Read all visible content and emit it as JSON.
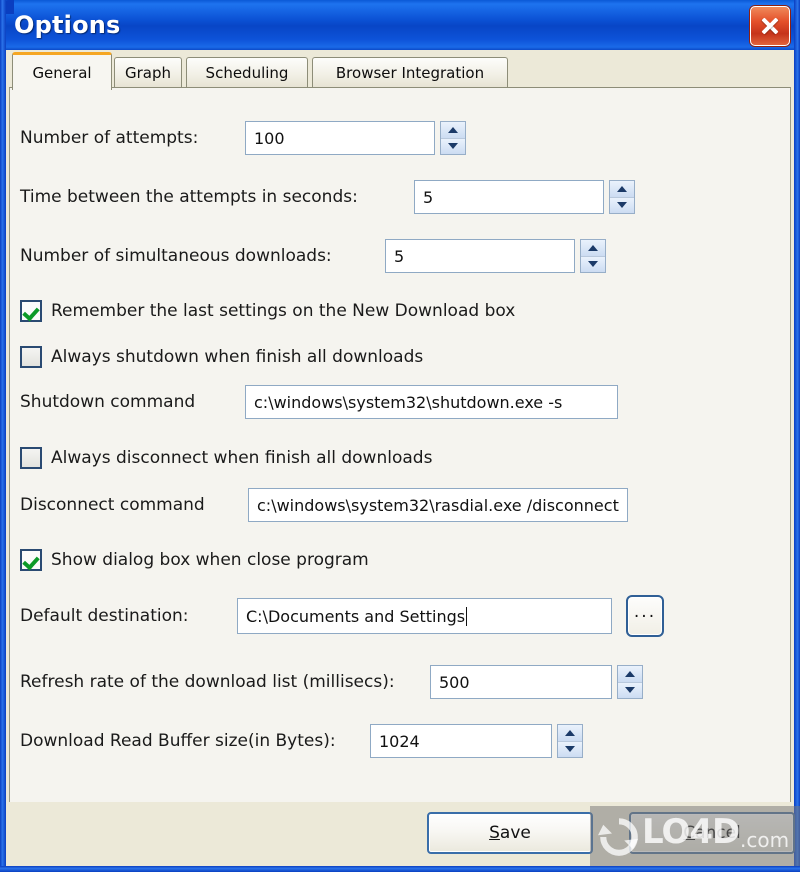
{
  "window": {
    "title": "Options",
    "close_label": "Close"
  },
  "tabs": [
    {
      "id": "general",
      "label": "General",
      "active": true
    },
    {
      "id": "graph",
      "label": "Graph",
      "active": false
    },
    {
      "id": "scheduling",
      "label": "Scheduling",
      "active": false
    },
    {
      "id": "browser",
      "label": "Browser Integration",
      "active": false
    }
  ],
  "general": {
    "attempts": {
      "label": "Number of attempts:",
      "value": "100"
    },
    "time_between": {
      "label": "Time between the attempts in seconds:",
      "value": "5"
    },
    "simultaneous": {
      "label": "Number of simultaneous downloads:",
      "value": "5"
    },
    "remember_settings": {
      "label": "Remember the last settings on the New Download box",
      "checked": true
    },
    "always_shutdown": {
      "label": "Always shutdown when finish all downloads",
      "checked": false
    },
    "shutdown_command": {
      "label": "Shutdown command",
      "value": "c:\\windows\\system32\\shutdown.exe -s"
    },
    "always_disconnect": {
      "label": "Always disconnect when finish all downloads",
      "checked": false
    },
    "disconnect_command": {
      "label": "Disconnect command",
      "value": "c:\\windows\\system32\\rasdial.exe /disconnect"
    },
    "show_dialog": {
      "label": "Show dialog box when close program",
      "checked": true
    },
    "default_destination": {
      "label": "Default destination:",
      "value": "C:\\Documents and Settings"
    },
    "browse": {
      "label": "..."
    },
    "refresh_rate": {
      "label": "Refresh rate of the download list (millisecs):",
      "value": "500"
    },
    "read_buffer": {
      "label": "Download Read Buffer size(in Bytes):",
      "value": "1024"
    }
  },
  "buttons": {
    "save": {
      "prefix": "",
      "accel": "S",
      "rest": "ave"
    },
    "cancel": {
      "prefix": "",
      "accel": "C",
      "rest": "ancel"
    }
  },
  "watermark": {
    "name": "LO4D",
    "tld": ".com"
  },
  "colors": {
    "titlebar_blue": "#0b51d4",
    "accent_orange": "#f5a623",
    "close_red": "#e4502a",
    "check_green": "#0c9a28",
    "dialog_beige": "#ece9d8",
    "panel": "#f5f4ef"
  }
}
